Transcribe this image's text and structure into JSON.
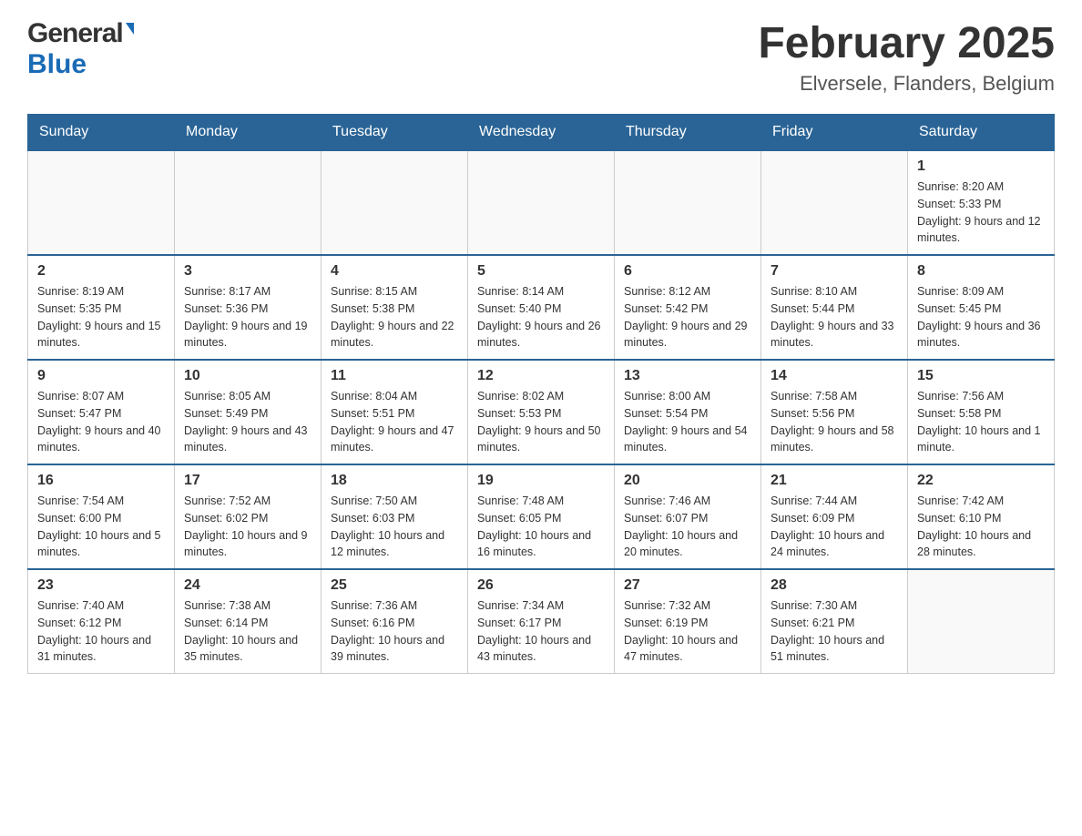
{
  "header": {
    "logo_general": "General",
    "logo_blue": "Blue",
    "month_year": "February 2025",
    "location": "Elversele, Flanders, Belgium"
  },
  "days_of_week": [
    "Sunday",
    "Monday",
    "Tuesday",
    "Wednesday",
    "Thursday",
    "Friday",
    "Saturday"
  ],
  "weeks": [
    {
      "days": [
        {
          "date": "",
          "info": ""
        },
        {
          "date": "",
          "info": ""
        },
        {
          "date": "",
          "info": ""
        },
        {
          "date": "",
          "info": ""
        },
        {
          "date": "",
          "info": ""
        },
        {
          "date": "",
          "info": ""
        },
        {
          "date": "1",
          "info": "Sunrise: 8:20 AM\nSunset: 5:33 PM\nDaylight: 9 hours and 12 minutes."
        }
      ]
    },
    {
      "days": [
        {
          "date": "2",
          "info": "Sunrise: 8:19 AM\nSunset: 5:35 PM\nDaylight: 9 hours and 15 minutes."
        },
        {
          "date": "3",
          "info": "Sunrise: 8:17 AM\nSunset: 5:36 PM\nDaylight: 9 hours and 19 minutes."
        },
        {
          "date": "4",
          "info": "Sunrise: 8:15 AM\nSunset: 5:38 PM\nDaylight: 9 hours and 22 minutes."
        },
        {
          "date": "5",
          "info": "Sunrise: 8:14 AM\nSunset: 5:40 PM\nDaylight: 9 hours and 26 minutes."
        },
        {
          "date": "6",
          "info": "Sunrise: 8:12 AM\nSunset: 5:42 PM\nDaylight: 9 hours and 29 minutes."
        },
        {
          "date": "7",
          "info": "Sunrise: 8:10 AM\nSunset: 5:44 PM\nDaylight: 9 hours and 33 minutes."
        },
        {
          "date": "8",
          "info": "Sunrise: 8:09 AM\nSunset: 5:45 PM\nDaylight: 9 hours and 36 minutes."
        }
      ]
    },
    {
      "days": [
        {
          "date": "9",
          "info": "Sunrise: 8:07 AM\nSunset: 5:47 PM\nDaylight: 9 hours and 40 minutes."
        },
        {
          "date": "10",
          "info": "Sunrise: 8:05 AM\nSunset: 5:49 PM\nDaylight: 9 hours and 43 minutes."
        },
        {
          "date": "11",
          "info": "Sunrise: 8:04 AM\nSunset: 5:51 PM\nDaylight: 9 hours and 47 minutes."
        },
        {
          "date": "12",
          "info": "Sunrise: 8:02 AM\nSunset: 5:53 PM\nDaylight: 9 hours and 50 minutes."
        },
        {
          "date": "13",
          "info": "Sunrise: 8:00 AM\nSunset: 5:54 PM\nDaylight: 9 hours and 54 minutes."
        },
        {
          "date": "14",
          "info": "Sunrise: 7:58 AM\nSunset: 5:56 PM\nDaylight: 9 hours and 58 minutes."
        },
        {
          "date": "15",
          "info": "Sunrise: 7:56 AM\nSunset: 5:58 PM\nDaylight: 10 hours and 1 minute."
        }
      ]
    },
    {
      "days": [
        {
          "date": "16",
          "info": "Sunrise: 7:54 AM\nSunset: 6:00 PM\nDaylight: 10 hours and 5 minutes."
        },
        {
          "date": "17",
          "info": "Sunrise: 7:52 AM\nSunset: 6:02 PM\nDaylight: 10 hours and 9 minutes."
        },
        {
          "date": "18",
          "info": "Sunrise: 7:50 AM\nSunset: 6:03 PM\nDaylight: 10 hours and 12 minutes."
        },
        {
          "date": "19",
          "info": "Sunrise: 7:48 AM\nSunset: 6:05 PM\nDaylight: 10 hours and 16 minutes."
        },
        {
          "date": "20",
          "info": "Sunrise: 7:46 AM\nSunset: 6:07 PM\nDaylight: 10 hours and 20 minutes."
        },
        {
          "date": "21",
          "info": "Sunrise: 7:44 AM\nSunset: 6:09 PM\nDaylight: 10 hours and 24 minutes."
        },
        {
          "date": "22",
          "info": "Sunrise: 7:42 AM\nSunset: 6:10 PM\nDaylight: 10 hours and 28 minutes."
        }
      ]
    },
    {
      "days": [
        {
          "date": "23",
          "info": "Sunrise: 7:40 AM\nSunset: 6:12 PM\nDaylight: 10 hours and 31 minutes."
        },
        {
          "date": "24",
          "info": "Sunrise: 7:38 AM\nSunset: 6:14 PM\nDaylight: 10 hours and 35 minutes."
        },
        {
          "date": "25",
          "info": "Sunrise: 7:36 AM\nSunset: 6:16 PM\nDaylight: 10 hours and 39 minutes."
        },
        {
          "date": "26",
          "info": "Sunrise: 7:34 AM\nSunset: 6:17 PM\nDaylight: 10 hours and 43 minutes."
        },
        {
          "date": "27",
          "info": "Sunrise: 7:32 AM\nSunset: 6:19 PM\nDaylight: 10 hours and 47 minutes."
        },
        {
          "date": "28",
          "info": "Sunrise: 7:30 AM\nSunset: 6:21 PM\nDaylight: 10 hours and 51 minutes."
        },
        {
          "date": "",
          "info": ""
        }
      ]
    }
  ]
}
